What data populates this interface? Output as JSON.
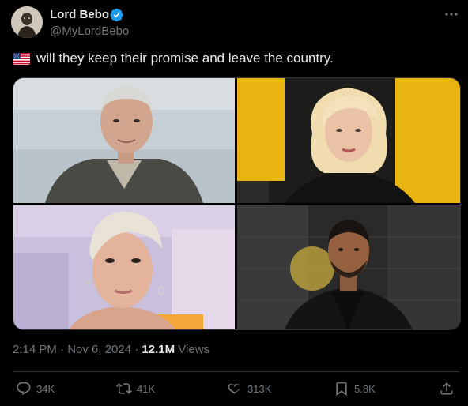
{
  "post": {
    "display_name": "Lord Bebo",
    "handle": "@MyLordBebo",
    "verified": true,
    "text": "will they keep their promise and leave the country.",
    "flag_emoji": "us-flag",
    "timestamp": "2:14 PM · Nov 6, 2024 · ",
    "views_count": "12.1M",
    "views_label": " Views"
  },
  "actions": {
    "replies": "34K",
    "reposts": "41K",
    "likes": "313K",
    "bookmarks": "5.8K"
  },
  "icons": {
    "verified": "verified-badge-icon",
    "more": "more-icon",
    "reply": "reply-icon",
    "repost": "repost-icon",
    "like": "heart-icon",
    "bookmark": "bookmark-icon",
    "share": "share-icon"
  },
  "colors": {
    "background": "#000000",
    "text": "#e7e9ea",
    "secondary": "#71767b",
    "accent": "#1d9bf0",
    "border": "#2f3336"
  }
}
